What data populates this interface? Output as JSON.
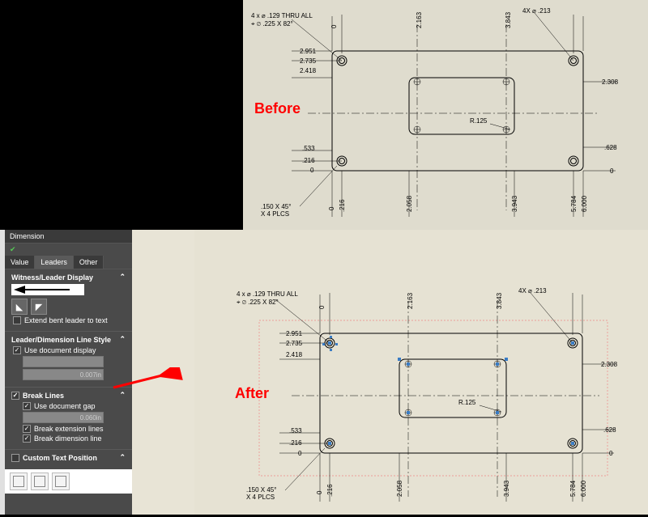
{
  "panel": {
    "title": "Dimension",
    "ok_icon": "✔",
    "tabs": [
      "Value",
      "Leaders",
      "Other"
    ],
    "active_tab": 1,
    "wld": {
      "title": "Witness/Leader Display",
      "extend_bent": "Extend bent leader to text"
    },
    "line_style": {
      "title": "Leader/Dimension Line Style",
      "use_doc": "Use document display",
      "val": "0.007in"
    },
    "break_lines": {
      "title": "Break Lines",
      "use_gap": "Use document gap",
      "gap_val": "0.060in",
      "ext": "Break extension lines",
      "dim": "Break dimension line"
    },
    "custom_text": {
      "title": "Custom Text Position"
    }
  },
  "labels": {
    "before": "Before",
    "after": "After"
  },
  "dwg": {
    "note_top": "4 x ⌀ .129 THRU ALL",
    "note_top2": "⌖ ⌀ .225 X 82°",
    "note_right": "4X ⌀ .213",
    "note_bl": ".150 X 45°",
    "note_bl2": "X 4 PLCS",
    "r125": "R.125",
    "y": {
      "v0": "0",
      "v216": ".216",
      "v533": ".533",
      "v628": ".628",
      "v2308": "2.308",
      "v2418": "2.418",
      "v2735": "2.735",
      "v2951": "2.951"
    },
    "x": {
      "v0": "0",
      "v216": ".216",
      "v2058": "2.058",
      "v2163": "2.163",
      "v3843": "3.843",
      "v3943": "3.943",
      "v5784": "5.784",
      "v6000": "6.000"
    }
  }
}
